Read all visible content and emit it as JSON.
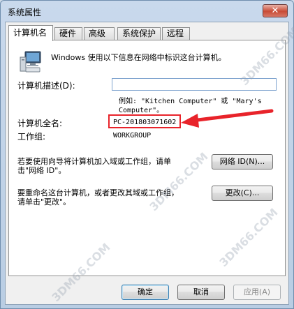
{
  "window": {
    "title": "系统属性",
    "close_glyph": "✕"
  },
  "tabs": [
    {
      "label": "计算机名",
      "active": true
    },
    {
      "label": "硬件",
      "active": false
    },
    {
      "label": "高级",
      "active": false
    },
    {
      "label": "系统保护",
      "active": false
    },
    {
      "label": "远程",
      "active": false
    }
  ],
  "info": {
    "description_line": "Windows 使用以下信息在网络中标识这台计算机。"
  },
  "computer_description": {
    "label": "计算机描述(D):",
    "value": "",
    "example_line1": "例如: \"Kitchen Computer\" 或 \"Mary's",
    "example_line2": "Computer\"。"
  },
  "full_name": {
    "label": "计算机全名:",
    "value": "PC-201803071602"
  },
  "workgroup": {
    "label": "工作组:",
    "value": "WORKGROUP"
  },
  "network_id": {
    "text_line1": "若要使用向导将计算机加入域或工作组，请单",
    "text_line2": "击\"网络 ID\"。",
    "button_label": "网络 ID(N)..."
  },
  "rename": {
    "text_line1": "要重命名这台计算机，或者更改其域或工作组，",
    "text_line2": "请单击\"更改\"。",
    "button_label": "更改(C)..."
  },
  "footer": {
    "ok_label": "确定",
    "cancel_label": "取消",
    "apply_label": "应用(A)"
  },
  "watermarks": [
    "3DM66.COM",
    "3DM66.COM",
    "3DM66.COM",
    "3DM66.COM"
  ],
  "colors": {
    "annotation_red": "#e8232a"
  }
}
